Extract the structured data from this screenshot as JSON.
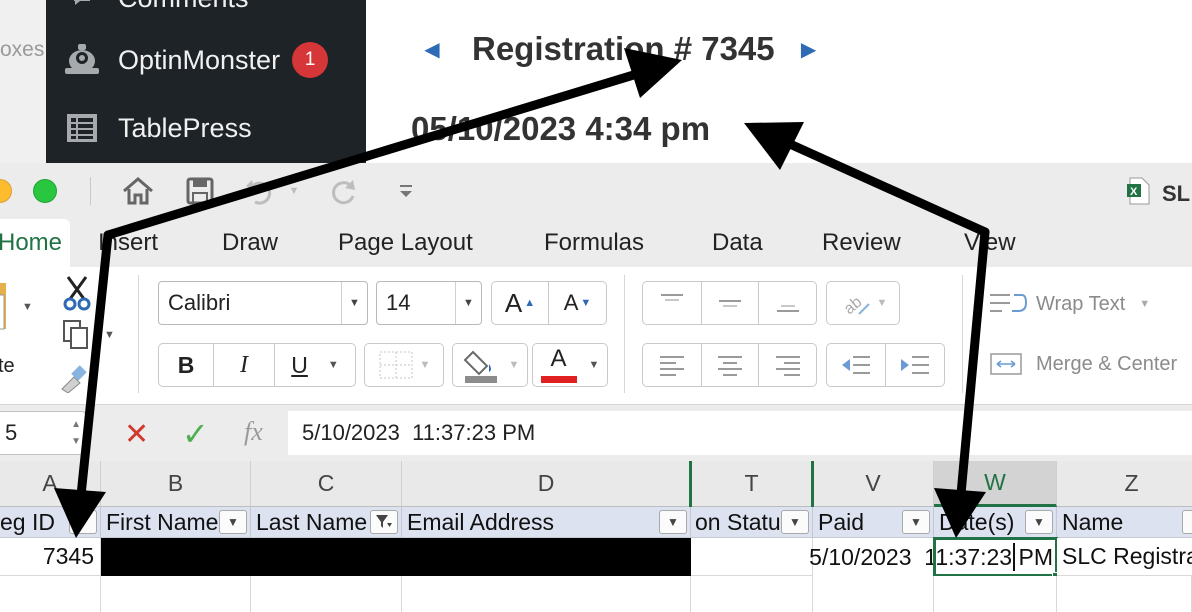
{
  "wordpress": {
    "left_strip_text": "oxes",
    "sidebar": {
      "comments_label": "Comments",
      "optinmonster_label": "OptinMonster",
      "optinmonster_badge": "1",
      "tablepress_label": "TablePress"
    },
    "registration": {
      "title": "Registration # 7345",
      "datetime": "05/10/2023 4:34 pm"
    }
  },
  "excel": {
    "doc_title": "SL",
    "tabs": [
      "Home",
      "Insert",
      "Draw",
      "Page Layout",
      "Formulas",
      "Data",
      "Review",
      "View"
    ],
    "clipboard": {
      "paste_label": "Paste",
      "paste_partial": "te"
    },
    "font": {
      "name": "Calibri",
      "size": "14",
      "grow": "A",
      "shrink": "A",
      "bold": "B",
      "italic": "I",
      "underline": "U",
      "font_color": "A"
    },
    "alignment": {
      "wrap_text": "Wrap Text",
      "merge_center": "Merge & Center"
    },
    "formula_bar": {
      "name_box": "5",
      "fx": "fx",
      "value": "5/10/2023  11:37:23 PM"
    },
    "columns": [
      {
        "letter": "A",
        "header": "eg ID",
        "value": "7345"
      },
      {
        "letter": "B",
        "header": "First Name",
        "value": ""
      },
      {
        "letter": "C",
        "header": "Last Name",
        "value": ""
      },
      {
        "letter": "D",
        "header": "Email Address",
        "value": ""
      },
      {
        "letter": "T",
        "header": "on Status",
        "value": ""
      },
      {
        "letter": "V",
        "header": "Paid",
        "value": ""
      },
      {
        "letter": "W",
        "header": "Date(s)",
        "value": "5/10/2023  11:37:23 PM"
      },
      {
        "letter": "Z",
        "header": "Name",
        "value": "SLC Registration"
      }
    ],
    "colors": {
      "accent_green": "#217346",
      "filter_row": "#dde2f1",
      "redacted": "#000000"
    }
  }
}
